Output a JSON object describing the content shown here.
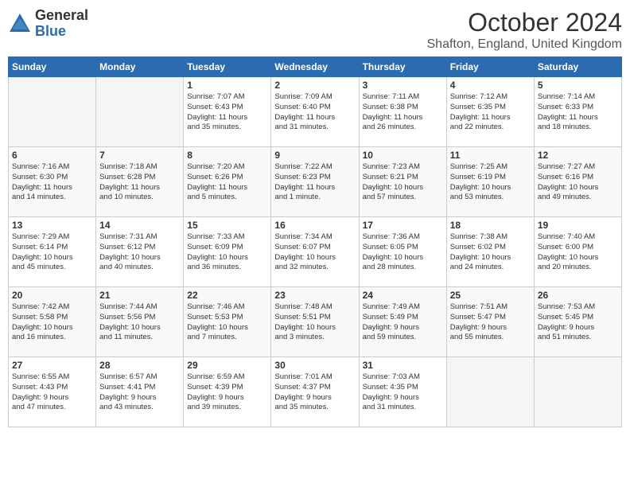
{
  "header": {
    "logo_general": "General",
    "logo_blue": "Blue",
    "title": "October 2024",
    "subtitle": "Shafton, England, United Kingdom"
  },
  "days_of_week": [
    "Sunday",
    "Monday",
    "Tuesday",
    "Wednesday",
    "Thursday",
    "Friday",
    "Saturday"
  ],
  "weeks": [
    [
      {
        "day": "",
        "info": ""
      },
      {
        "day": "",
        "info": ""
      },
      {
        "day": "1",
        "info": "Sunrise: 7:07 AM\nSunset: 6:43 PM\nDaylight: 11 hours\nand 35 minutes."
      },
      {
        "day": "2",
        "info": "Sunrise: 7:09 AM\nSunset: 6:40 PM\nDaylight: 11 hours\nand 31 minutes."
      },
      {
        "day": "3",
        "info": "Sunrise: 7:11 AM\nSunset: 6:38 PM\nDaylight: 11 hours\nand 26 minutes."
      },
      {
        "day": "4",
        "info": "Sunrise: 7:12 AM\nSunset: 6:35 PM\nDaylight: 11 hours\nand 22 minutes."
      },
      {
        "day": "5",
        "info": "Sunrise: 7:14 AM\nSunset: 6:33 PM\nDaylight: 11 hours\nand 18 minutes."
      }
    ],
    [
      {
        "day": "6",
        "info": "Sunrise: 7:16 AM\nSunset: 6:30 PM\nDaylight: 11 hours\nand 14 minutes."
      },
      {
        "day": "7",
        "info": "Sunrise: 7:18 AM\nSunset: 6:28 PM\nDaylight: 11 hours\nand 10 minutes."
      },
      {
        "day": "8",
        "info": "Sunrise: 7:20 AM\nSunset: 6:26 PM\nDaylight: 11 hours\nand 5 minutes."
      },
      {
        "day": "9",
        "info": "Sunrise: 7:22 AM\nSunset: 6:23 PM\nDaylight: 11 hours\nand 1 minute."
      },
      {
        "day": "10",
        "info": "Sunrise: 7:23 AM\nSunset: 6:21 PM\nDaylight: 10 hours\nand 57 minutes."
      },
      {
        "day": "11",
        "info": "Sunrise: 7:25 AM\nSunset: 6:19 PM\nDaylight: 10 hours\nand 53 minutes."
      },
      {
        "day": "12",
        "info": "Sunrise: 7:27 AM\nSunset: 6:16 PM\nDaylight: 10 hours\nand 49 minutes."
      }
    ],
    [
      {
        "day": "13",
        "info": "Sunrise: 7:29 AM\nSunset: 6:14 PM\nDaylight: 10 hours\nand 45 minutes."
      },
      {
        "day": "14",
        "info": "Sunrise: 7:31 AM\nSunset: 6:12 PM\nDaylight: 10 hours\nand 40 minutes."
      },
      {
        "day": "15",
        "info": "Sunrise: 7:33 AM\nSunset: 6:09 PM\nDaylight: 10 hours\nand 36 minutes."
      },
      {
        "day": "16",
        "info": "Sunrise: 7:34 AM\nSunset: 6:07 PM\nDaylight: 10 hours\nand 32 minutes."
      },
      {
        "day": "17",
        "info": "Sunrise: 7:36 AM\nSunset: 6:05 PM\nDaylight: 10 hours\nand 28 minutes."
      },
      {
        "day": "18",
        "info": "Sunrise: 7:38 AM\nSunset: 6:02 PM\nDaylight: 10 hours\nand 24 minutes."
      },
      {
        "day": "19",
        "info": "Sunrise: 7:40 AM\nSunset: 6:00 PM\nDaylight: 10 hours\nand 20 minutes."
      }
    ],
    [
      {
        "day": "20",
        "info": "Sunrise: 7:42 AM\nSunset: 5:58 PM\nDaylight: 10 hours\nand 16 minutes."
      },
      {
        "day": "21",
        "info": "Sunrise: 7:44 AM\nSunset: 5:56 PM\nDaylight: 10 hours\nand 11 minutes."
      },
      {
        "day": "22",
        "info": "Sunrise: 7:46 AM\nSunset: 5:53 PM\nDaylight: 10 hours\nand 7 minutes."
      },
      {
        "day": "23",
        "info": "Sunrise: 7:48 AM\nSunset: 5:51 PM\nDaylight: 10 hours\nand 3 minutes."
      },
      {
        "day": "24",
        "info": "Sunrise: 7:49 AM\nSunset: 5:49 PM\nDaylight: 9 hours\nand 59 minutes."
      },
      {
        "day": "25",
        "info": "Sunrise: 7:51 AM\nSunset: 5:47 PM\nDaylight: 9 hours\nand 55 minutes."
      },
      {
        "day": "26",
        "info": "Sunrise: 7:53 AM\nSunset: 5:45 PM\nDaylight: 9 hours\nand 51 minutes."
      }
    ],
    [
      {
        "day": "27",
        "info": "Sunrise: 6:55 AM\nSunset: 4:43 PM\nDaylight: 9 hours\nand 47 minutes."
      },
      {
        "day": "28",
        "info": "Sunrise: 6:57 AM\nSunset: 4:41 PM\nDaylight: 9 hours\nand 43 minutes."
      },
      {
        "day": "29",
        "info": "Sunrise: 6:59 AM\nSunset: 4:39 PM\nDaylight: 9 hours\nand 39 minutes."
      },
      {
        "day": "30",
        "info": "Sunrise: 7:01 AM\nSunset: 4:37 PM\nDaylight: 9 hours\nand 35 minutes."
      },
      {
        "day": "31",
        "info": "Sunrise: 7:03 AM\nSunset: 4:35 PM\nDaylight: 9 hours\nand 31 minutes."
      },
      {
        "day": "",
        "info": ""
      },
      {
        "day": "",
        "info": ""
      }
    ]
  ]
}
